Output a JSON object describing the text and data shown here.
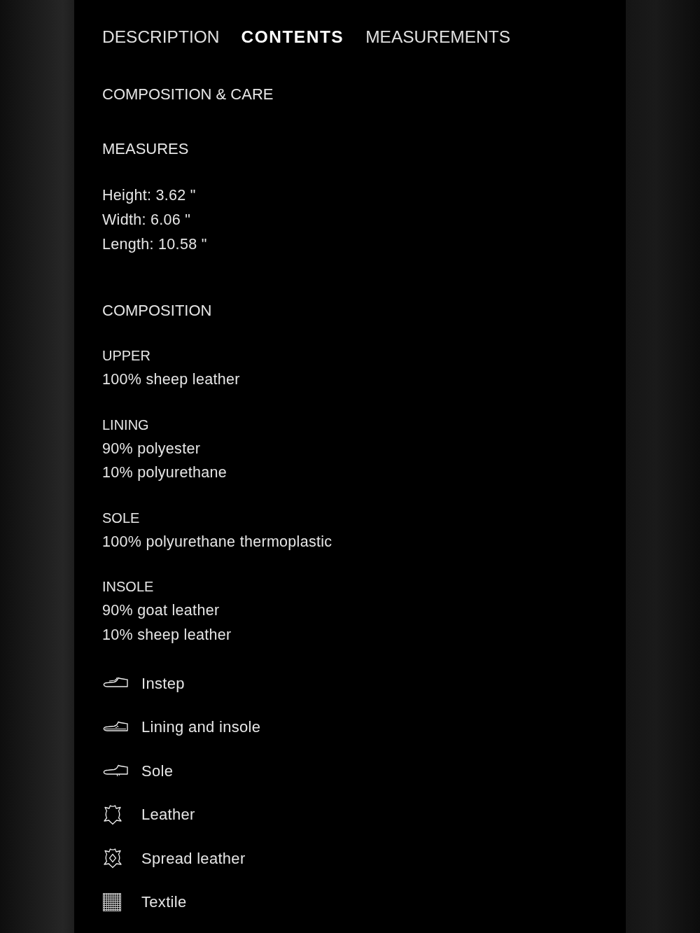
{
  "tabs": [
    {
      "label": "DESCRIPTION",
      "selected": false
    },
    {
      "label": "CONTENTS",
      "selected": true
    },
    {
      "label": "MEASUREMENTS",
      "selected": false
    }
  ],
  "section_title": "COMPOSITION & CARE",
  "measures": {
    "heading": "MEASURES",
    "lines": [
      "Height: 3.62 \"",
      "Width: 6.06 \"",
      "Length: 10.58 \""
    ]
  },
  "composition": {
    "heading": "COMPOSITION",
    "parts": [
      {
        "name": "UPPER",
        "materials": [
          "100% sheep leather"
        ]
      },
      {
        "name": "LINING",
        "materials": [
          "90% polyester",
          "10% polyurethane"
        ]
      },
      {
        "name": "SOLE",
        "materials": [
          "100% polyurethane thermoplastic"
        ]
      },
      {
        "name": "INSOLE",
        "materials": [
          "90% goat leather",
          "10% sheep leather"
        ]
      }
    ]
  },
  "legend": [
    {
      "kind": "instep",
      "label": "Instep"
    },
    {
      "kind": "lining",
      "label": "Lining and insole"
    },
    {
      "kind": "sole",
      "label": "Sole"
    },
    {
      "kind": "leather",
      "label": "Leather"
    },
    {
      "kind": "spread",
      "label": "Spread leather"
    },
    {
      "kind": "textile",
      "label": "Textile"
    }
  ]
}
